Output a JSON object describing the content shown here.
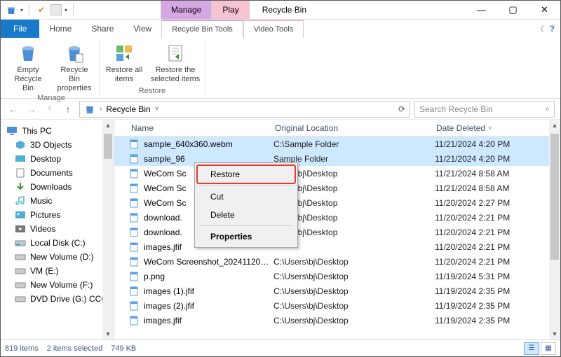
{
  "title": "Recycle Bin",
  "tabs": {
    "file": "File",
    "home": "Home",
    "share": "Share",
    "view": "View",
    "manage": "Manage",
    "rbt": "Recycle Bin Tools",
    "play": "Play",
    "vt": "Video Tools"
  },
  "ribbon": {
    "empty": "Empty Recycle Bin",
    "props": "Recycle Bin properties",
    "restore_all": "Restore all items",
    "restore_sel": "Restore the selected items",
    "grp_manage": "Manage",
    "grp_restore": "Restore"
  },
  "address": {
    "location": "Recycle Bin",
    "search_ph": "Search Recycle Bin"
  },
  "nav": {
    "thispc": "This PC",
    "items": [
      "3D Objects",
      "Desktop",
      "Documents",
      "Downloads",
      "Music",
      "Pictures",
      "Videos",
      "Local Disk (C:)",
      "New Volume (D:)",
      "VM (E:)",
      "New Volume (F:)",
      "DVD Drive (G:) CCC"
    ]
  },
  "columns": {
    "name": "Name",
    "orig": "Original Location",
    "date": "Date Deleted"
  },
  "files": [
    {
      "name": "sample_640x360.webm",
      "orig": "C:\\Sample Folder",
      "date": "11/21/2024 4:20 PM",
      "sel": true
    },
    {
      "name": "sample_96",
      "orig": "Sample Folder",
      "date": "11/21/2024 4:20 PM",
      "sel": true,
      "covered": true
    },
    {
      "name": "WeCom Sc",
      "orig": "Users\\bj\\Desktop",
      "date": "11/21/2024 8:58 AM"
    },
    {
      "name": "WeCom Sc",
      "orig": "Users\\bj\\Desktop",
      "date": "11/21/2024 8:58 AM"
    },
    {
      "name": "WeCom Sc",
      "orig": "Users\\bj\\Desktop",
      "date": "11/20/2024 2:27 PM"
    },
    {
      "name": "download.",
      "orig": "Users\\bj\\Desktop",
      "date": "11/20/2024 2:21 PM"
    },
    {
      "name": "download.",
      "orig": "Users\\bj\\Desktop",
      "date": "11/20/2024 2:21 PM"
    },
    {
      "name": "images.jfif",
      "orig": "",
      "date": "11/20/2024 2:21 PM"
    },
    {
      "name": "WeCom Screenshot_202411201014...",
      "orig": "C:\\Users\\bj\\Desktop",
      "date": "11/20/2024 2:21 PM"
    },
    {
      "name": "p.png",
      "orig": "C:\\Users\\bj\\Desktop",
      "date": "11/19/2024 5:31 PM"
    },
    {
      "name": "images (1).jfif",
      "orig": "C:\\Users\\bj\\Desktop",
      "date": "11/19/2024 2:35 PM"
    },
    {
      "name": "images (2).jfif",
      "orig": "C:\\Users\\bj\\Desktop",
      "date": "11/19/2024 2:35 PM"
    },
    {
      "name": "images.jfif",
      "orig": "C:\\Users\\bj\\Desktop",
      "date": "11/19/2024 2:35 PM"
    }
  ],
  "ctxmenu": {
    "restore": "Restore",
    "cut": "Cut",
    "delete": "Delete",
    "props": "Properties"
  },
  "status": {
    "count": "819 items",
    "sel": "2 items selected",
    "size": "749 KB"
  }
}
